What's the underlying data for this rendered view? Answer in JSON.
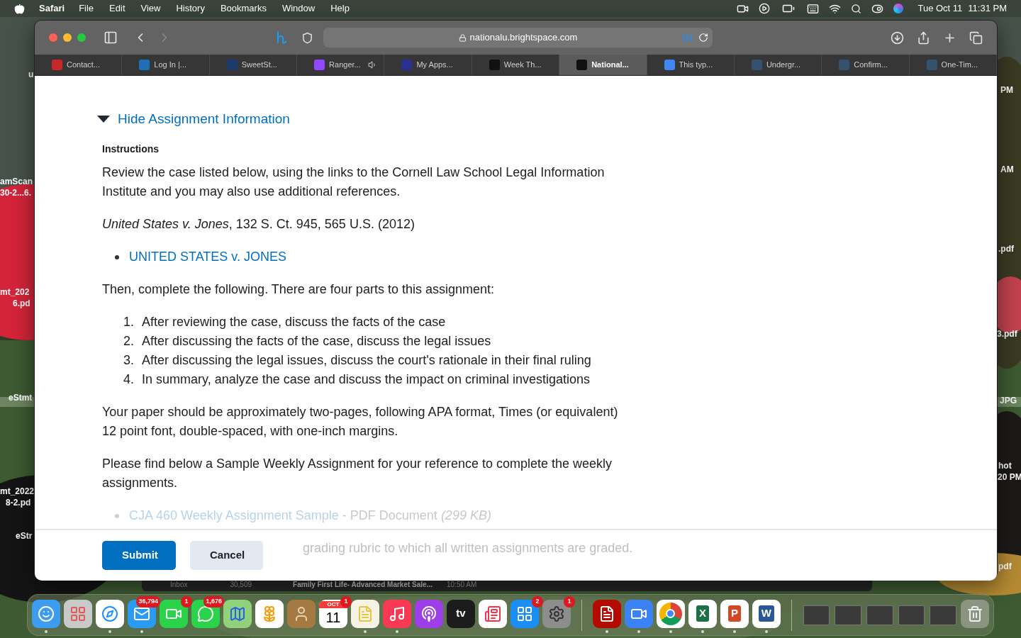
{
  "menu_bar": {
    "app": "Safari",
    "items": [
      "File",
      "Edit",
      "View",
      "History",
      "Bookmarks",
      "Window",
      "Help"
    ],
    "date": "Tue Oct 11",
    "time": "11:31 PM"
  },
  "desktop_labels": [
    {
      "text": "u"
    },
    {
      "text": "amScan"
    },
    {
      "text": "30-2...6."
    },
    {
      "text": "mt_202"
    },
    {
      "text": "6.pd"
    },
    {
      "text": "eStmt"
    },
    {
      "text": "mt_2022"
    },
    {
      "text": "8-2.pd"
    },
    {
      "text": "eStr"
    },
    {
      "text": "PM"
    },
    {
      "text": "AM"
    },
    {
      "text": ".pdf"
    },
    {
      "text": "3.pdf"
    },
    {
      "text": "JPG"
    },
    {
      "text": "hot"
    },
    {
      "text": "20 PM"
    },
    {
      "text": "pdf"
    }
  ],
  "browser": {
    "address": "nationalu.brightspace.com",
    "audio_playing": true,
    "tabs": [
      {
        "title": "Contact...",
        "selected": false,
        "color": "#c62828"
      },
      {
        "title": "Log In |...",
        "selected": false,
        "color": "#1e6fb8"
      },
      {
        "title": "SweetSt...",
        "selected": false,
        "color": "#1a3a6b"
      },
      {
        "title": "Ranger...",
        "selected": false,
        "color": "#9146ff",
        "audio": true
      },
      {
        "title": "My Apps...",
        "selected": false,
        "color": "#2b2f8f"
      },
      {
        "title": "Week Th...",
        "selected": false,
        "color": "#111111"
      },
      {
        "title": "National...",
        "selected": true,
        "color": "#111111"
      },
      {
        "title": "This typ...",
        "selected": false,
        "color": "#4285f4"
      },
      {
        "title": "Undergr...",
        "selected": false,
        "color": "#34516e"
      },
      {
        "title": "Confirm...",
        "selected": false,
        "color": "#34516e"
      },
      {
        "title": "One-Tim...",
        "selected": false,
        "color": "#34516e"
      }
    ]
  },
  "page": {
    "toggle": "Hide Assignment Information",
    "expanded": true,
    "heading": "Instructions",
    "blocks": [
      {
        "kind": "paragraph",
        "text": "Review the case listed below, using the links to the Cornell Law School Legal Information Institute and you may also use additional references."
      },
      {
        "kind": "paragraph",
        "text": "*United States v. Jones*, 132 S. Ct. 945, 565 U.S. (2012)"
      },
      {
        "kind": "links",
        "items": [
          "UNITED STATES v. JONES"
        ]
      },
      {
        "kind": "paragraph",
        "text": "Then, complete the following. There are four parts to this assignment:"
      },
      {
        "kind": "numbered",
        "items": [
          {
            "number": "1.",
            "text": "After reviewing the case, discuss the facts of the case"
          },
          {
            "number": "2.",
            "text": "After discussing the facts of the case, discuss the legal issues"
          },
          {
            "number": "3.",
            "text": "After discussing the legal issues, discuss the court's rationale in their final ruling"
          },
          {
            "number": "4.",
            "text": "In summary, analyze the case and discuss the impact on criminal investigations"
          }
        ]
      },
      {
        "kind": "paragraph",
        "text": "Your paper should be approximately two-pages, following APA format, Times (or equivalent) 12 point font, double-spaced, with one-inch margins."
      },
      {
        "kind": "paragraph",
        "text": "Please find below a Sample Weekly Assignment for your reference to complete the weekly assignments."
      },
      {
        "kind": "attachment",
        "link": "CJA 460 Weekly Assignment Sample",
        "info": " - PDF Document *(299 KB)*"
      },
      {
        "kind": "partial",
        "text": "grading rubric to which all written assignments are graded."
      }
    ]
  },
  "footer": {
    "buttons": [
      {
        "label": "Submit",
        "kind": "primary"
      },
      {
        "label": "Cancel",
        "kind": "secondary"
      }
    ]
  },
  "mail_window": {
    "folder": "Inbox",
    "count": "30,509",
    "subject": "Family First Life- Advanced Market Sale...",
    "time": "10:50 AM"
  },
  "dock": [
    {
      "kind": "finder",
      "running": true
    },
    {
      "kind": "launchpad",
      "running": false
    },
    {
      "kind": "safari",
      "running": true
    },
    {
      "kind": "mail",
      "running": true,
      "badge": "36,794"
    },
    {
      "kind": "facetime",
      "running": false,
      "badge": "1"
    },
    {
      "kind": "messages",
      "running": false,
      "badge": "1,676"
    },
    {
      "kind": "maps",
      "running": false
    },
    {
      "kind": "photos",
      "running": false
    },
    {
      "kind": "contacts",
      "running": false
    },
    {
      "kind": "calendar",
      "running": false,
      "badge": "1",
      "month": "OCT",
      "day": "11"
    },
    {
      "kind": "notes",
      "running": true
    },
    {
      "kind": "music",
      "running": true
    },
    {
      "kind": "podcasts",
      "running": false
    },
    {
      "kind": "tv",
      "running": false,
      "glyph": "tv"
    },
    {
      "kind": "news",
      "running": false
    },
    {
      "kind": "appstore",
      "running": false,
      "badge": "2"
    },
    {
      "kind": "settings",
      "running": false,
      "badge": "1"
    },
    {
      "kind": "separator"
    },
    {
      "kind": "acrobat",
      "running": true
    },
    {
      "kind": "zoom",
      "running": true
    },
    {
      "kind": "chrome",
      "running": true
    },
    {
      "kind": "excel",
      "running": true,
      "glyph": "X"
    },
    {
      "kind": "powerpoint",
      "running": true,
      "glyph": "P"
    },
    {
      "kind": "word",
      "running": true,
      "glyph": "W"
    },
    {
      "kind": "separator"
    },
    {
      "kind": "window"
    },
    {
      "kind": "window"
    },
    {
      "kind": "window"
    },
    {
      "kind": "window"
    },
    {
      "kind": "window"
    },
    {
      "kind": "trash",
      "running": false
    }
  ]
}
